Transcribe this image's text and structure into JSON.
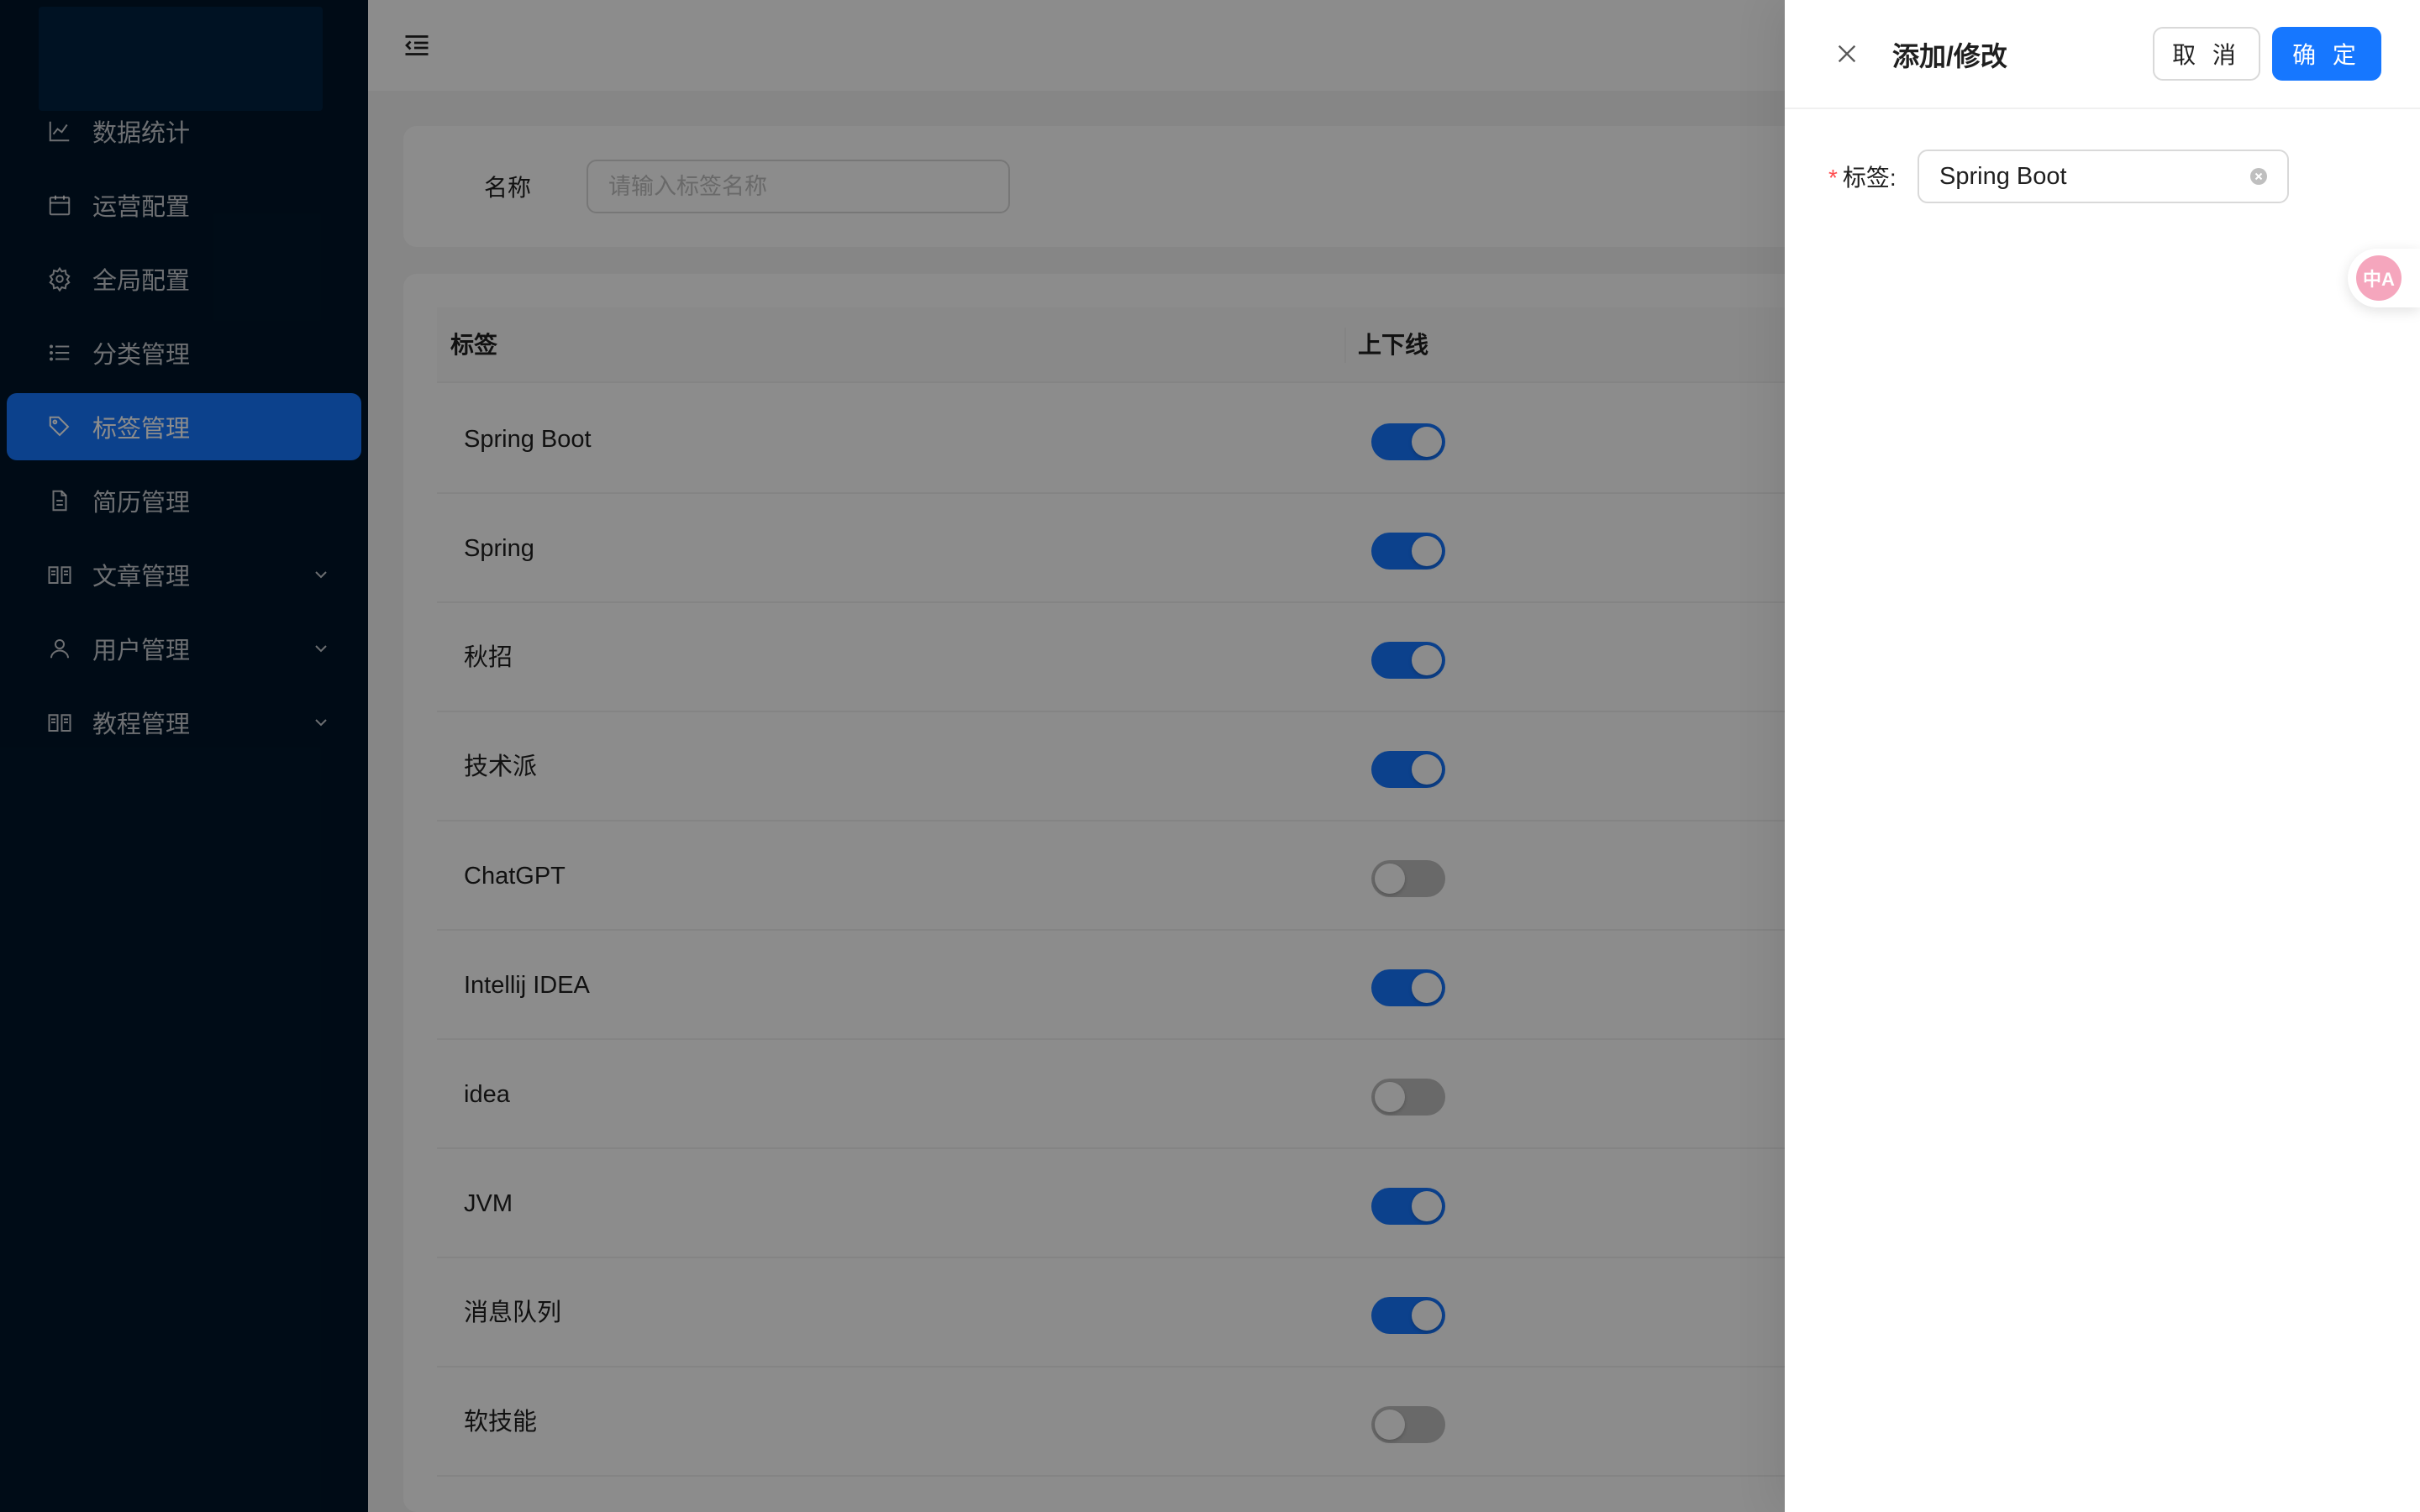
{
  "sidebar": {
    "items": [
      {
        "label": "数据统计",
        "icon": "line-chart-icon"
      },
      {
        "label": "运营配置",
        "icon": "calendar-icon"
      },
      {
        "label": "全局配置",
        "icon": "gear-icon"
      },
      {
        "label": "分类管理",
        "icon": "list-icon"
      },
      {
        "label": "标签管理",
        "icon": "tag-icon",
        "active": true
      },
      {
        "label": "简历管理",
        "icon": "file-icon"
      },
      {
        "label": "文章管理",
        "icon": "book-icon",
        "expandable": true
      },
      {
        "label": "用户管理",
        "icon": "user-icon",
        "expandable": true
      },
      {
        "label": "教程管理",
        "icon": "book-icon",
        "expandable": true
      }
    ]
  },
  "search": {
    "label": "名称",
    "placeholder": "请输入标签名称"
  },
  "table": {
    "columns": [
      "标签",
      "上下线"
    ],
    "rows": [
      {
        "name": "Spring Boot",
        "online": true
      },
      {
        "name": "Spring",
        "online": true
      },
      {
        "name": "秋招",
        "online": true
      },
      {
        "name": "技术派",
        "online": true
      },
      {
        "name": "ChatGPT",
        "online": false
      },
      {
        "name": "Intellij IDEA",
        "online": true
      },
      {
        "name": "idea",
        "online": false
      },
      {
        "name": "JVM",
        "online": true
      },
      {
        "name": "消息队列",
        "online": true
      },
      {
        "name": "软技能",
        "online": false
      }
    ]
  },
  "drawer": {
    "title": "添加/修改",
    "cancel_label": "取 消",
    "ok_label": "确 定",
    "form": {
      "required_mark": "*",
      "tag_label": "标签:",
      "tag_value": "Spring Boot"
    }
  },
  "translate_fab": {
    "text": "中A"
  },
  "colors": {
    "sidebar_bg": "#001529",
    "primary": "#1677ff",
    "switch_off": "#bfbfbf",
    "required": "#ff4d4f"
  }
}
